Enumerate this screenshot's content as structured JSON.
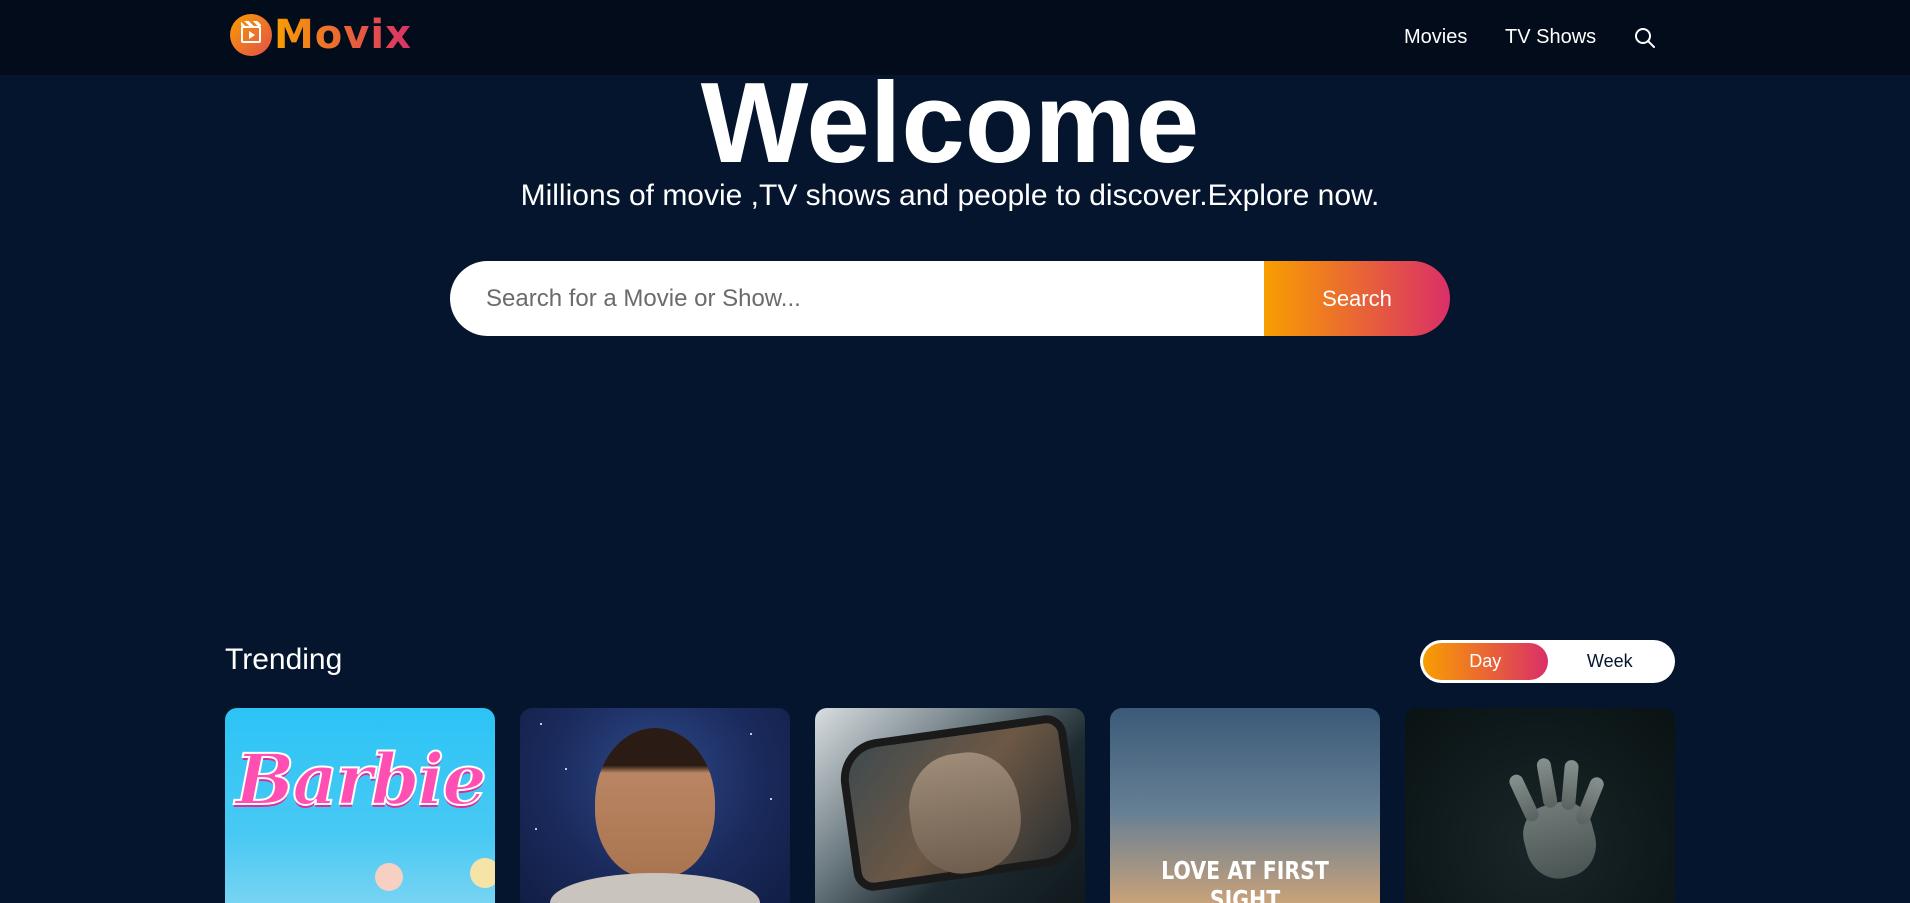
{
  "header": {
    "logo_text": "Movix",
    "nav": [
      {
        "label": "Movies"
      },
      {
        "label": "TV Shows"
      }
    ],
    "search_icon": "search-icon"
  },
  "hero": {
    "title": "Welcome",
    "subtitle": "Millions of movie ,TV shows and people to discover.Explore now.",
    "search": {
      "placeholder": "Search for a Movie or Show...",
      "value": "",
      "button_label": "Search"
    }
  },
  "trending": {
    "title": "Trending",
    "tabs": [
      {
        "label": "Day",
        "active": true
      },
      {
        "label": "Week",
        "active": false
      }
    ],
    "cards": [
      {
        "poster_text": "Barbie"
      },
      {
        "poster_text": ""
      },
      {
        "poster_text": ""
      },
      {
        "poster_text": "LOVE AT FIRST SIGHT"
      },
      {
        "poster_text": ""
      }
    ]
  },
  "colors": {
    "background": "#04152d",
    "header": "#020c1b",
    "gradient_start": "#f89e00",
    "gradient_end": "#da2f68",
    "text": "#ffffff"
  }
}
